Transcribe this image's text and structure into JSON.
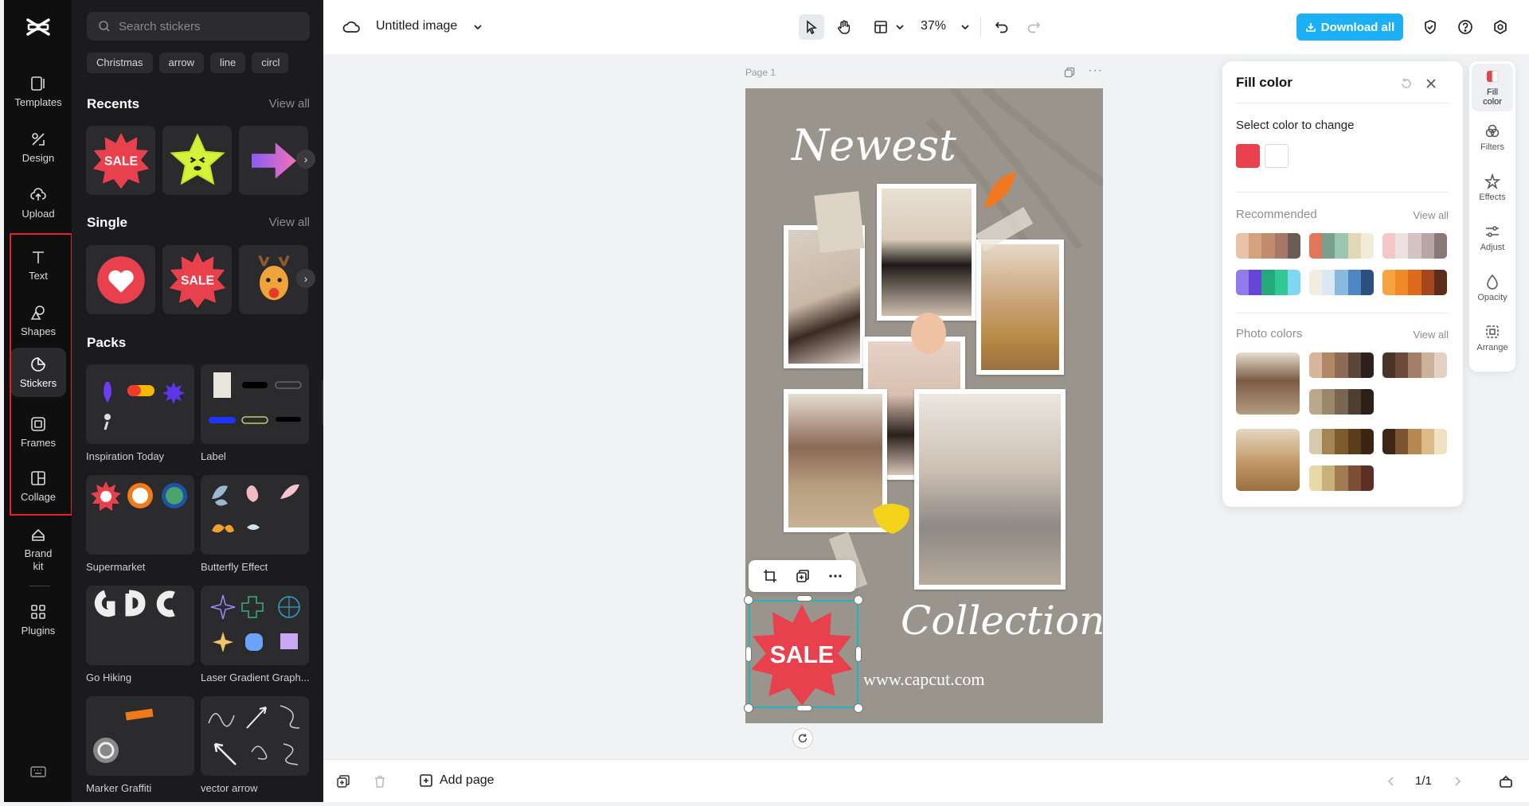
{
  "rail": {
    "items": [
      {
        "label": "Templates",
        "icon": "templates-icon"
      },
      {
        "label": "Design",
        "icon": "design-icon"
      },
      {
        "label": "Upload",
        "icon": "upload-icon"
      },
      {
        "label": "Text",
        "icon": "text-icon"
      },
      {
        "label": "Shapes",
        "icon": "shapes-icon"
      },
      {
        "label": "Stickers",
        "icon": "stickers-icon"
      },
      {
        "label": "Frames",
        "icon": "frames-icon"
      },
      {
        "label": "Collage",
        "icon": "collage-icon"
      },
      {
        "label": "Brand kit",
        "icon": "brand-kit-icon"
      },
      {
        "label": "Plugins",
        "icon": "plugins-icon"
      }
    ],
    "active": "Stickers",
    "highlight_color": "#e3222b"
  },
  "stickers": {
    "search_placeholder": "Search stickers",
    "chips": [
      "Christmas",
      "arrow",
      "line",
      "circl"
    ],
    "recents": {
      "title": "Recents",
      "view_all": "View all"
    },
    "single": {
      "title": "Single",
      "view_all": "View all"
    },
    "packs": {
      "title": "Packs",
      "items": [
        "Inspiration Today",
        "Label",
        "Supermarket",
        "Butterfly Effect",
        "Go Hiking",
        "Laser Gradient Graph...",
        "Marker Graffiti",
        "vector arrow"
      ]
    },
    "sale_text": "SALE"
  },
  "topbar": {
    "title": "Untitled image",
    "zoom": "37%",
    "download": "Download all",
    "accent": "#1eb0f7"
  },
  "canvas": {
    "page_label": "Page 1",
    "headline": "Newest",
    "subline": "Collection",
    "url": "www.capcut.com",
    "sale": "SALE",
    "background": "#9a958c",
    "sale_color": "#e8414d"
  },
  "bottombar": {
    "add_page": "Add page",
    "pager": "1/1"
  },
  "fill_panel": {
    "title": "Fill color",
    "select_label": "Select color to change",
    "current_colors": [
      "#e8414d",
      "#ffffff"
    ],
    "recommended": {
      "title": "Recommended",
      "view_all": "View all",
      "palettes": [
        [
          "#e9c3a8",
          "#d4a27f",
          "#c08c6d",
          "#a77767",
          "#6a5b54"
        ],
        [
          "#e0765a",
          "#7a9f8a",
          "#9bc6b0",
          "#e2d8b8",
          "#f3ecd9"
        ],
        [
          "#f2c7c5",
          "#ece2e2",
          "#d5c2c3",
          "#b9a4a6",
          "#887978"
        ],
        [
          "#8f7bea",
          "#6645d6",
          "#23a97a",
          "#30c995",
          "#7fd7f4"
        ],
        [
          "#f1ede2",
          "#d9e8f3",
          "#8ab9e0",
          "#4e86c4",
          "#2d4f7e"
        ],
        [
          "#f6a443",
          "#f08a26",
          "#dc6b1c",
          "#a4471b",
          "#5c2b1a"
        ]
      ]
    },
    "photo_colors": {
      "title": "Photo colors",
      "view_all": "View all",
      "palettes": [
        [
          "#d6b59c",
          "#b18866",
          "#8c6a55",
          "#5b4638",
          "#2c211c"
        ],
        [
          "#4a3429",
          "#6b4a3a",
          "#a37f6a",
          "#cdb19b",
          "#e2d1c3"
        ],
        [
          "#b8a88c",
          "#9a8668",
          "#7a6650",
          "#4f3f32",
          "#2c2019"
        ],
        [
          "#d7c9b0",
          "#a38652",
          "#7e5b2d",
          "#5b3d1e",
          "#3a2414"
        ],
        [
          "#3d2714",
          "#7a5530",
          "#b58851",
          "#dbbb86",
          "#efe2c4"
        ],
        [
          "#e8d9a9",
          "#c9b27a",
          "#a27b53",
          "#7d4e36",
          "#5b2f24"
        ]
      ]
    }
  },
  "right_rail": {
    "items": [
      "Fill color",
      "Filters",
      "Effects",
      "Adjust",
      "Opacity",
      "Arrange"
    ]
  }
}
